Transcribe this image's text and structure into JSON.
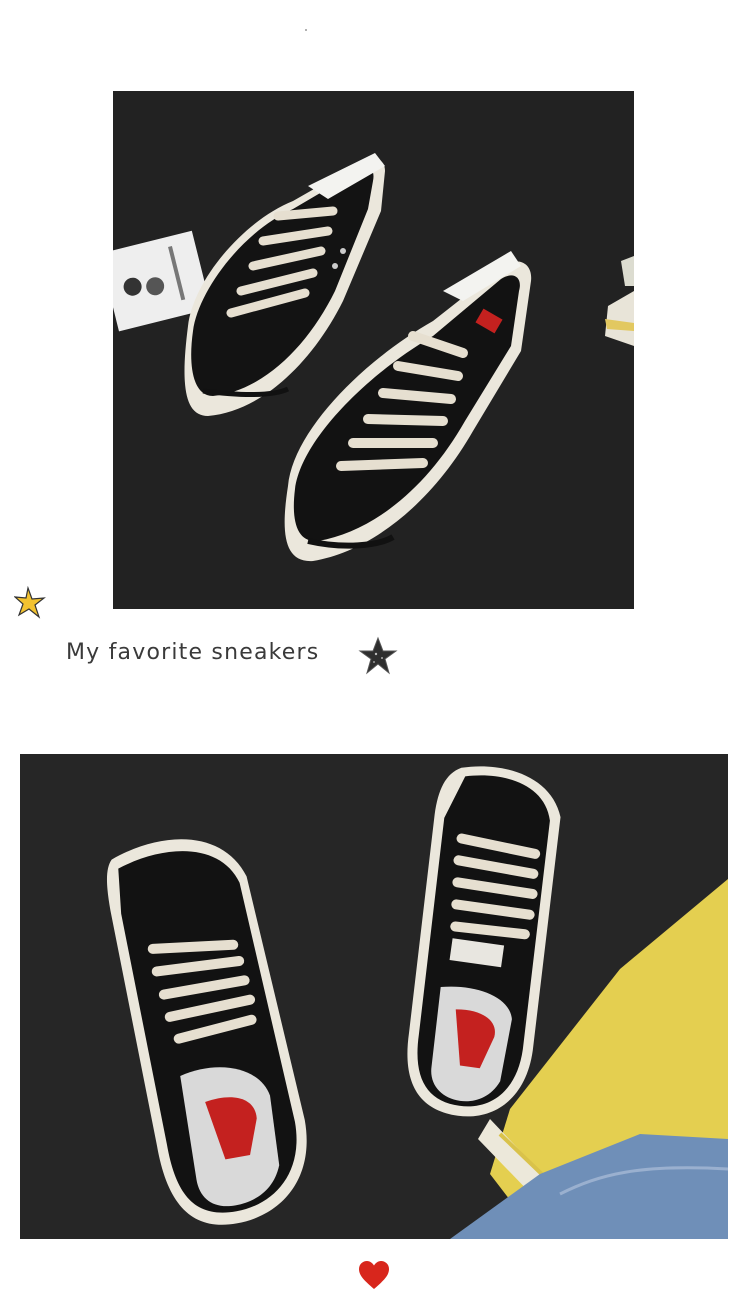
{
  "caption": {
    "text": "My favorite sneakers"
  },
  "icons": {
    "left_star": "gold-star-icon",
    "caption_star": "glitter-star-icon",
    "bottom_heart": "heart-icon"
  },
  "colors": {
    "shoe_canvas": "#111111",
    "shoe_sole": "#efebe0",
    "laces": "#e6dfd0",
    "background": "#232323",
    "insole_red": "#c4211f",
    "sweater_yellow": "#e4cf50",
    "denim": "#6f8fb8",
    "heart": "#d8261c",
    "gold_star": "#f2c230"
  }
}
